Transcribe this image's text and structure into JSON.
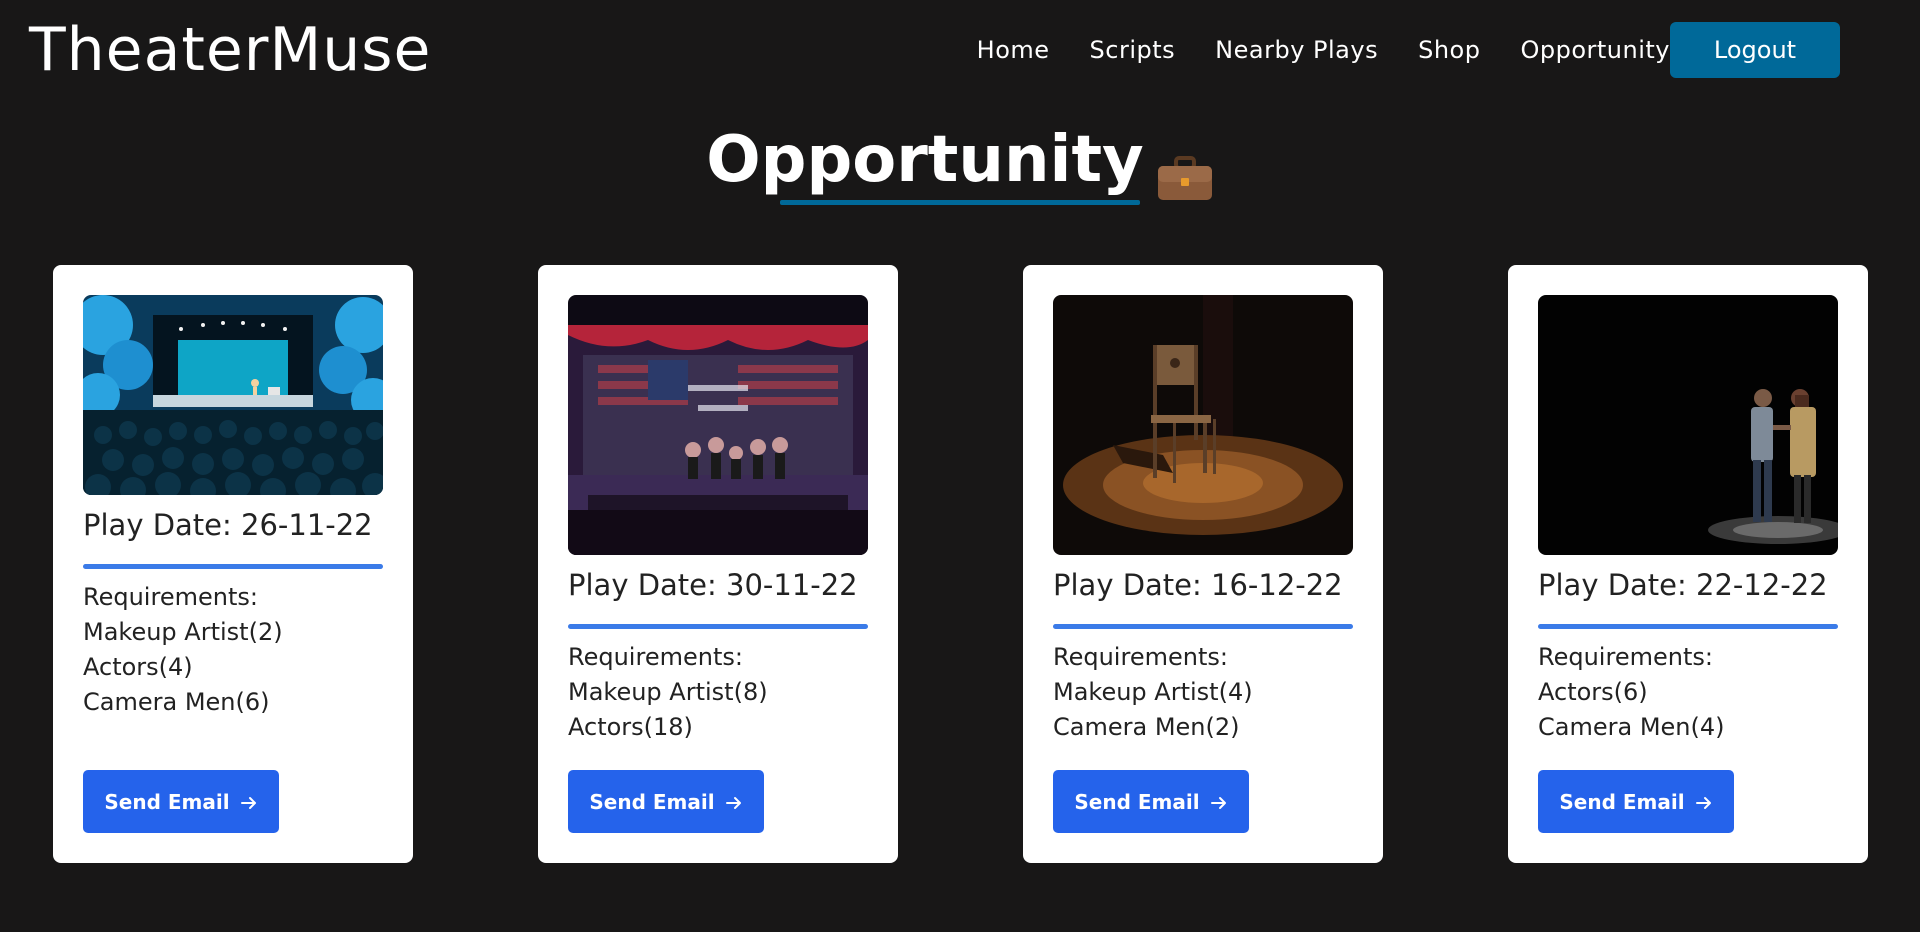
{
  "brand": "TheaterMuse",
  "nav": {
    "items": [
      "Home",
      "Scripts",
      "Nearby Plays",
      "Shop",
      "Opportunity"
    ],
    "logout_label": "Logout"
  },
  "page": {
    "title": "Opportunity",
    "title_icon": "briefcase-icon"
  },
  "colors": {
    "background": "#181717",
    "accent": "#006999",
    "card_divider": "#3b7be8",
    "button": "#2563eb"
  },
  "cards": [
    {
      "image": "theater-audience-stage",
      "play_date": "Play Date: 26-11-22",
      "requirements_label": "Requirements:",
      "requirements": [
        "Makeup Artist(2)",
        "Actors(4)",
        "Camera Men(6)"
      ],
      "button_label": "Send Email",
      "button_icon": "arrow-right-icon"
    },
    {
      "image": "stage-performance-dancers",
      "play_date": "Play Date: 30-11-22",
      "requirements_label": "Requirements:",
      "requirements": [
        "Makeup Artist(8)",
        "Actors(18)"
      ],
      "button_label": "Send Email",
      "button_icon": "arrow-right-icon"
    },
    {
      "image": "spotlit-chair",
      "play_date": "Play Date: 16-12-22",
      "requirements_label": "Requirements:",
      "requirements": [
        "Makeup Artist(4)",
        "Camera Men(2)"
      ],
      "button_label": "Send Email",
      "button_icon": "arrow-right-icon"
    },
    {
      "image": "two-actors-dark-stage",
      "play_date": "Play Date: 22-12-22",
      "requirements_label": "Requirements:",
      "requirements": [
        "Actors(6)",
        "Camera Men(4)"
      ],
      "button_label": "Send Email",
      "button_icon": "arrow-right-icon"
    }
  ]
}
